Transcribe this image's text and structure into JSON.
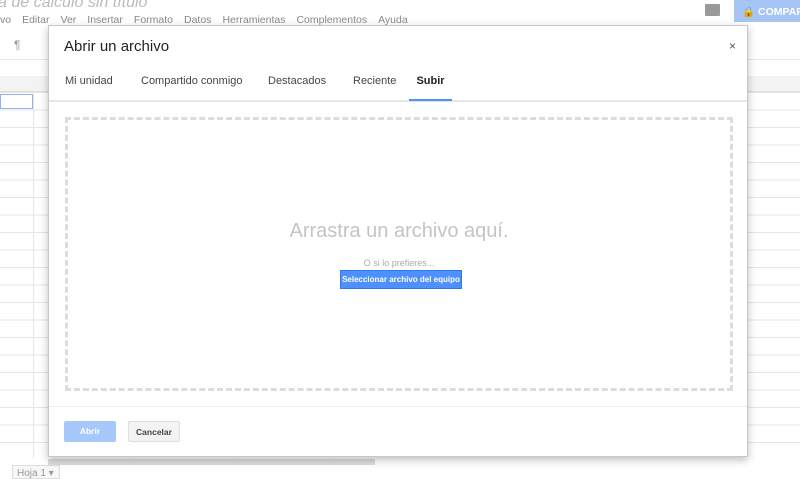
{
  "app": {
    "doc_title": "a de cálculo sin título",
    "menu": [
      "vo",
      "Editar",
      "Ver",
      "Insertar",
      "Formato",
      "Datos",
      "Herramientas",
      "Complementos",
      "Ayuda"
    ],
    "share_label": "COMPARTIR",
    "sheet_tab": "Hoja 1 ▾"
  },
  "dialog": {
    "title": "Abrir un archivo",
    "close": "×",
    "tabs": [
      {
        "label": "Mi unidad"
      },
      {
        "label": "Compartido conmigo"
      },
      {
        "label": "Destacados"
      },
      {
        "label": "Reciente"
      },
      {
        "label": "Subir",
        "active": true
      }
    ],
    "drop_text": "Arrastra un archivo aquí.",
    "or_text": "O si lo prefieres...",
    "select_button": "Seleccionar archivo del equipo",
    "open_button": "Abrir",
    "cancel_button": "Cancelar"
  },
  "colors": {
    "accent": "#4d90fe",
    "disabled": "#a6c8fb"
  }
}
